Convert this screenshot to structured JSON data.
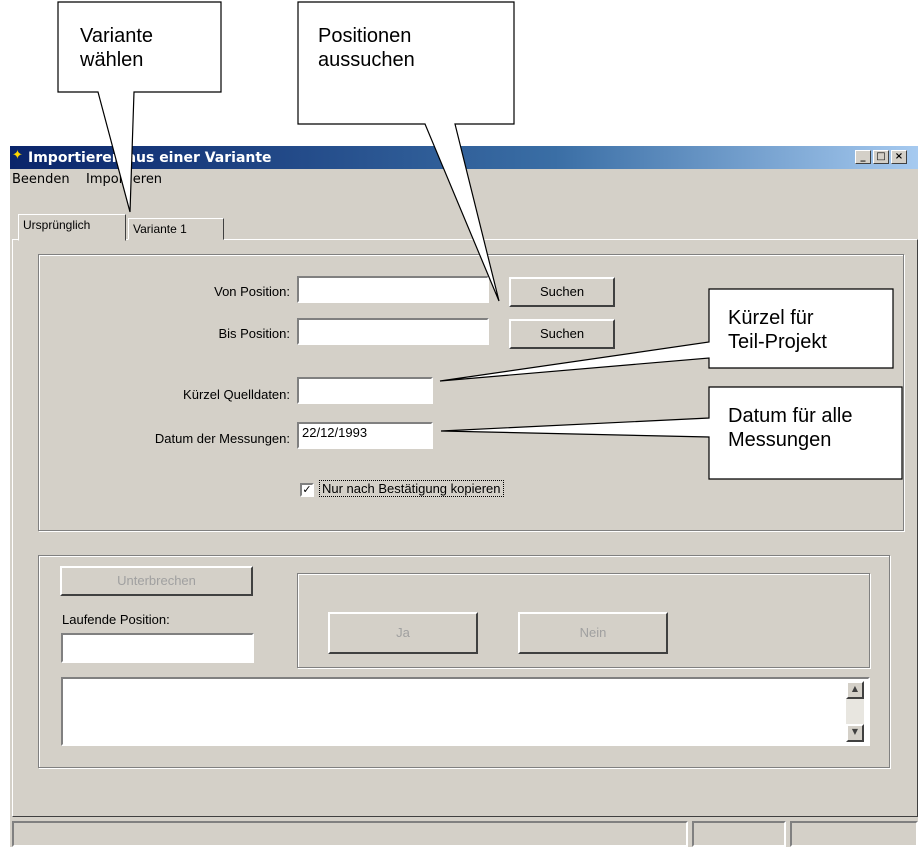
{
  "window": {
    "title": "Importieren aus einer Variante"
  },
  "menu": [
    "Beenden",
    "Importieren"
  ],
  "tabs": [
    "Ursprünglich",
    "Variante 1"
  ],
  "form": {
    "von_label": "Von Position:",
    "bis_label": "Bis Position:",
    "kuerzel_label": "Kürzel Quelldaten:",
    "datum_label": "Datum der Messungen:",
    "von_value": "",
    "bis_value": "",
    "kuerzel_value": "",
    "datum_value": "22/12/1993",
    "suchen_label": "Suchen",
    "checkbox_label": "Nur nach Bestätigung kopieren",
    "checkbox_checked": true
  },
  "progress": {
    "unterbrechen_label": "Unterbrechen",
    "laufende_label": "Laufende Position:",
    "laufende_value": "",
    "ja_label": "Ja",
    "nein_label": "Nein",
    "log_text": ""
  },
  "callouts": {
    "variante_line1": "Variante",
    "variante_line2": "wählen",
    "positionen_line1": "Positionen",
    "positionen_line2": "aussuchen",
    "kuerzel_line1": "Kürzel für",
    "kuerzel_line2": "Teil-Projekt",
    "datum_line1": "Datum für alle",
    "datum_line2": "Messungen"
  }
}
